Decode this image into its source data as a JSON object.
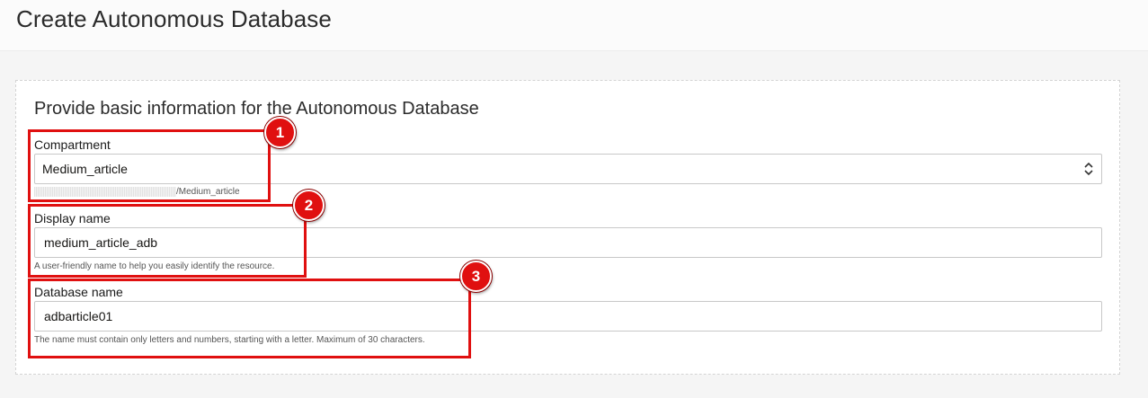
{
  "page": {
    "title": "Create Autonomous Database"
  },
  "section": {
    "title": "Provide basic information for the Autonomous Database"
  },
  "compartment": {
    "label": "Compartment",
    "value": "Medium_article",
    "path": "/Medium_article"
  },
  "display_name": {
    "label": "Display name",
    "value": "medium_article_adb",
    "helper": "A user-friendly name to help you easily identify the resource."
  },
  "database_name": {
    "label": "Database name",
    "value": "adbarticle01",
    "helper": "The name must contain only letters and numbers, starting with a letter. Maximum of 30 characters."
  },
  "annotations": [
    "1",
    "2",
    "3"
  ],
  "colors": {
    "highlight": "#e01010",
    "background": "#f5f5f5",
    "card": "#ffffff"
  }
}
